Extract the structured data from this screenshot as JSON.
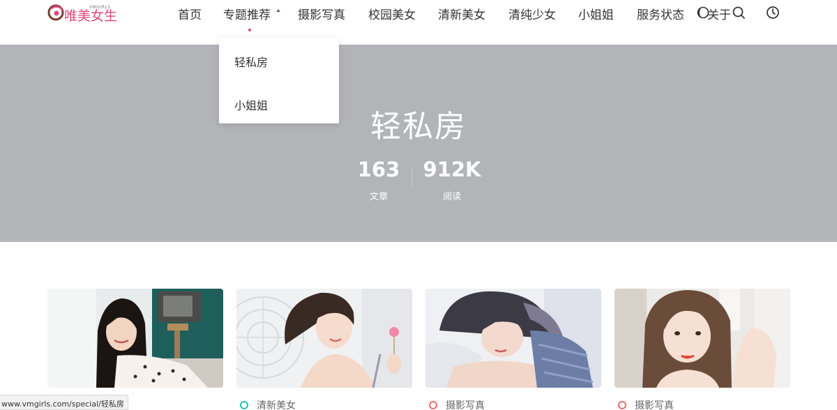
{
  "header": {
    "logo_text": "唯美女生",
    "logo_sub": "VMGIRLS",
    "nav": [
      {
        "label": "首页"
      },
      {
        "label": "专题推荐"
      },
      {
        "label": "摄影写真"
      },
      {
        "label": "校园美女"
      },
      {
        "label": "清新美女"
      },
      {
        "label": "清纯少女"
      },
      {
        "label": "小姐姐"
      },
      {
        "label": "服务状态"
      },
      {
        "label": "关于"
      }
    ],
    "icons": [
      "moon-icon",
      "search-icon",
      "clock-icon"
    ],
    "accent_color": "#e0457a"
  },
  "dropdown": {
    "items": [
      {
        "label": "轻私房"
      },
      {
        "label": "小姐姐"
      }
    ]
  },
  "hero": {
    "title": "轻私房",
    "stats": [
      {
        "value": "163",
        "label": "文章"
      },
      {
        "value": "912K",
        "label": "阅读"
      }
    ],
    "background_color": "#b2b4b8"
  },
  "cards": [
    {
      "category": "",
      "category_color": "#21c2b7"
    },
    {
      "category": "清新美女",
      "category_color": "#21c2b7"
    },
    {
      "category": "摄影写真",
      "category_color": "#f06a6a"
    },
    {
      "category": "摄影写真",
      "category_color": "#f06a6a"
    }
  ],
  "status_bar": {
    "url": "www.vmgirls.com/special/轻私房"
  }
}
